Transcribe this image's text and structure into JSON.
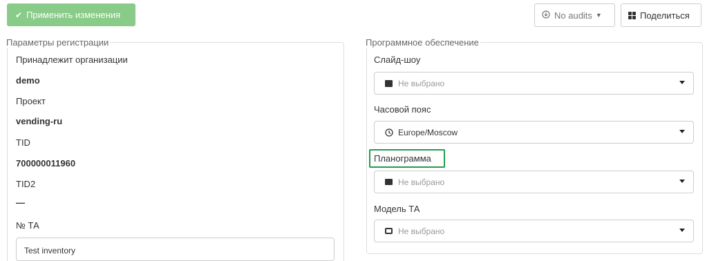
{
  "toolbar": {
    "apply_label": "Применить изменения",
    "audits_label": "No audits",
    "share_label": "Поделиться"
  },
  "registration": {
    "legend": "Параметры регистрации",
    "org_label": "Принадлежит организации",
    "org_value": "demo",
    "project_label": "Проект",
    "project_value": "vending-ru",
    "tid_label": "TID",
    "tid_value": "700000011960",
    "tid2_label": "TID2",
    "tid2_value": "—",
    "ta_label": "№ ТА",
    "ta_value": "Test inventory"
  },
  "software": {
    "legend": "Программное обеспечение",
    "slideshow_label": "Слайд-шоу",
    "slideshow_value": "Не выбрано",
    "timezone_label": "Часовой пояс",
    "timezone_value": "Europe/Moscow",
    "planogram_label": "Планограмма",
    "planogram_value": "Не выбрано",
    "model_label": "Модель ТА",
    "model_value": "Не выбрано"
  },
  "icons": {
    "apply": "check-icon",
    "audits": "download-circle-icon",
    "share": "qr-code-icon",
    "slideshow": "film-icon",
    "timezone": "clock-icon",
    "planogram": "list-icon",
    "model": "hdd-icon"
  },
  "colors": {
    "apply_button": "#5cb85c",
    "highlight": "#1e9e4a"
  }
}
